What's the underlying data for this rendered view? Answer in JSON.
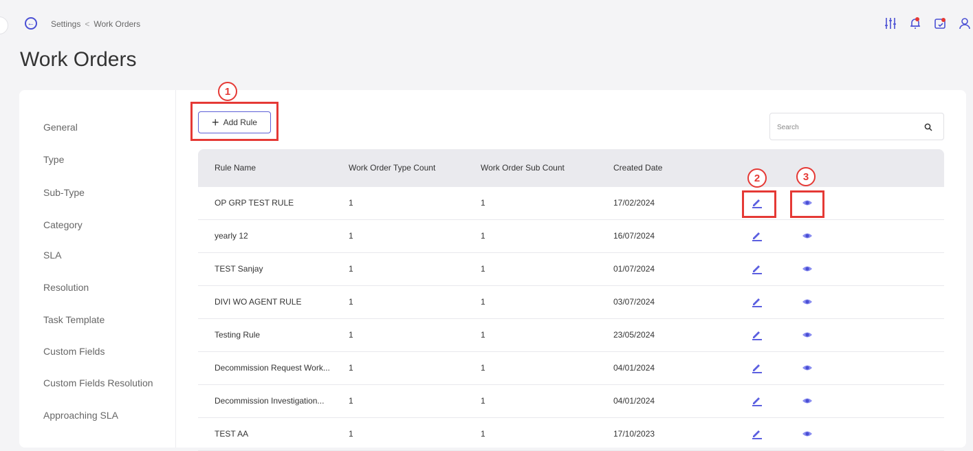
{
  "breadcrumb": {
    "parent": "Settings",
    "separator": "<",
    "current": "Work Orders"
  },
  "page": {
    "title": "Work Orders"
  },
  "sidebar": {
    "items": [
      {
        "label": "General"
      },
      {
        "label": "Type"
      },
      {
        "label": "Sub-Type"
      },
      {
        "label": "Category"
      },
      {
        "label": "SLA"
      },
      {
        "label": "Resolution"
      },
      {
        "label": "Task Template"
      },
      {
        "label": "Custom Fields"
      },
      {
        "label": "Custom Fields Resolution"
      },
      {
        "label": "Approaching SLA"
      }
    ]
  },
  "toolbar": {
    "add_rule_label": "Add Rule"
  },
  "search": {
    "placeholder": "Search"
  },
  "table": {
    "headers": [
      "Rule Name",
      "Work Order Type Count",
      "Work Order Sub Count",
      "Created Date"
    ],
    "rows": [
      [
        "OP GRP TEST RULE",
        "1",
        "1",
        "17/02/2024"
      ],
      [
        "yearly 12",
        "1",
        "1",
        "16/07/2024"
      ],
      [
        "TEST Sanjay",
        "1",
        "1",
        "01/07/2024"
      ],
      [
        "DIVI WO AGENT RULE",
        "1",
        "1",
        "03/07/2024"
      ],
      [
        "Testing Rule",
        "1",
        "1",
        "23/05/2024"
      ],
      [
        "Decommission Request Work...",
        "1",
        "1",
        "04/01/2024"
      ],
      [
        "Decommission Investigation...",
        "1",
        "1",
        "04/01/2024"
      ],
      [
        "TEST AA",
        "1",
        "1",
        "17/10/2023"
      ]
    ]
  },
  "annotations": {
    "one": "1",
    "two": "2",
    "three": "3"
  },
  "colors": {
    "accent": "#4a4fd4",
    "annotation": "#e53935",
    "icon_action": "#5b5fe0"
  },
  "icons": [
    "back-arrow-icon",
    "sliders-icon",
    "bell-icon",
    "calendar-check-icon",
    "user-icon",
    "search-icon",
    "plus-icon",
    "pencil-icon",
    "eye-icon"
  ]
}
